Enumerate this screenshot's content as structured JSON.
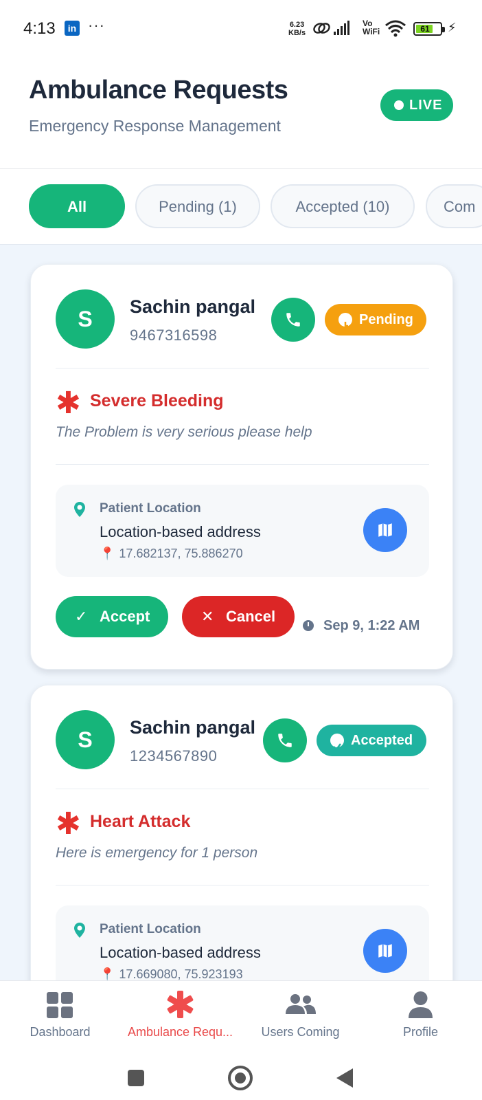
{
  "status_bar": {
    "time": "4:13",
    "app_badge": "in",
    "more": "···",
    "net_speed_value": "6.23",
    "net_speed_unit": "KB/s",
    "vowifi_top": "Vo",
    "vowifi_bottom": "WiFi",
    "battery": "61"
  },
  "header": {
    "title": "Ambulance Requests",
    "subtitle": "Emergency Response Management",
    "live_label": "LIVE"
  },
  "filters": [
    {
      "label": "All",
      "active": true
    },
    {
      "label": "Pending (1)",
      "active": false
    },
    {
      "label": "Accepted (10)",
      "active": false
    },
    {
      "label": "Com",
      "active": false
    }
  ],
  "requests": [
    {
      "avatar_initial": "S",
      "name": "Sachin pangal",
      "phone": "9467316598",
      "status": "Pending",
      "status_color": "#f5a00f",
      "emergency_type": "Severe Bleeding",
      "description": "The Problem is very serious please help",
      "location_label": "Patient Location",
      "address": "Location-based address",
      "coordinates": "17.682137, 75.886270",
      "accept_label": "Accept",
      "cancel_label": "Cancel",
      "timestamp": "Sep 9, 1:22 AM"
    },
    {
      "avatar_initial": "S",
      "name": "Sachin pangal",
      "phone": "1234567890",
      "status": "Accepted",
      "status_color": "#1fb3a0",
      "emergency_type": "Heart Attack",
      "description": "Here is emergency for 1 person",
      "location_label": "Patient Location",
      "address": "Location-based address",
      "coordinates": "17.669080, 75.923193"
    }
  ],
  "bottom_nav": [
    {
      "label": "Dashboard",
      "icon": "dashboard-icon",
      "active": false
    },
    {
      "label": "Ambulance Requ...",
      "icon": "medical-asterisk-icon",
      "active": true
    },
    {
      "label": "Users Coming",
      "icon": "users-icon",
      "active": false
    },
    {
      "label": "Profile",
      "icon": "profile-icon",
      "active": false
    }
  ],
  "colors": {
    "brand_green": "#16b57a",
    "danger_red": "#dc2626",
    "map_blue": "#3b82f6",
    "pending_orange": "#f5a00f",
    "accepted_teal": "#1fb3a0"
  }
}
